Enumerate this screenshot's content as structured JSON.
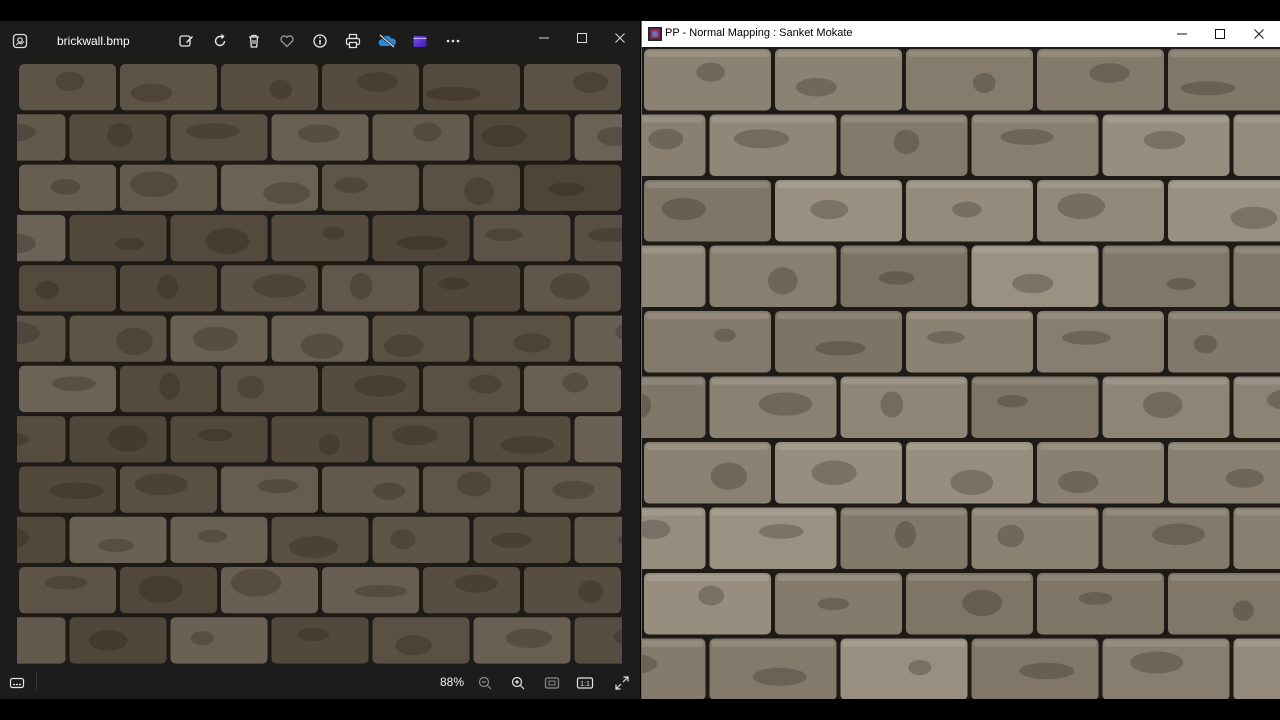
{
  "photos_window": {
    "filename": "brickwall.bmp",
    "toolbar_icons": [
      "edit-image-icon",
      "rotate-icon",
      "delete-icon",
      "favorite-icon",
      "info-icon",
      "print-icon",
      "onedrive-icon",
      "clipchamp-icon",
      "more-icon"
    ],
    "zoom_level": "88%",
    "status_icons": [
      "filmstrip-icon",
      "zoom-out-icon",
      "zoom-in-icon",
      "fit-to-window-icon",
      "actual-size-icon",
      "fullscreen-icon"
    ],
    "actual_size_label": "1:1",
    "image_tint": "#5e5347"
  },
  "pp_window": {
    "title": "PP - Normal Mapping : Sanket Mokate",
    "image_tint": "#8c8274"
  }
}
